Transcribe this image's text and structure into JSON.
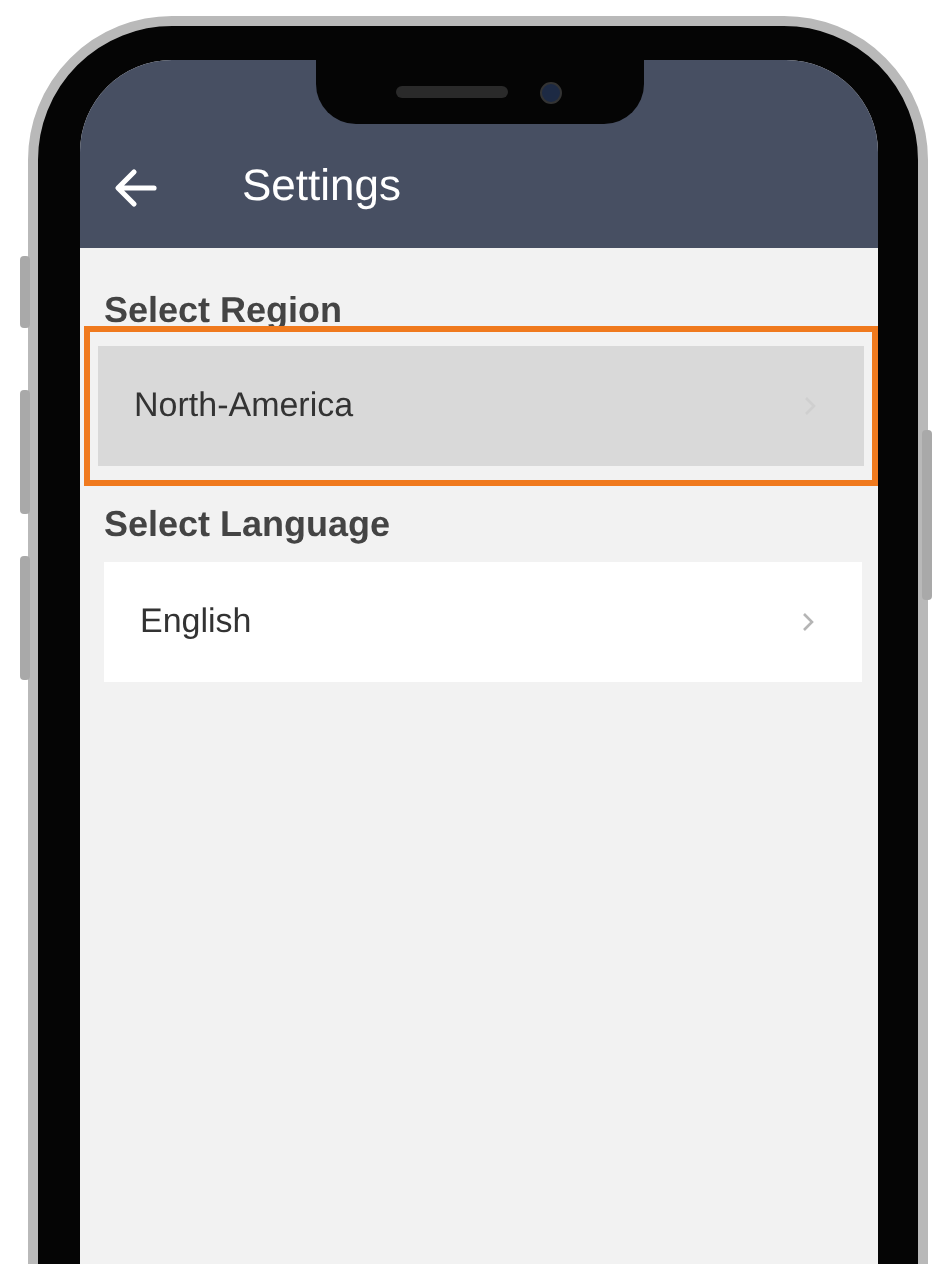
{
  "header": {
    "title": "Settings"
  },
  "sections": [
    {
      "label": "Select Region",
      "item": {
        "value": "North-America",
        "highlighted": true
      }
    },
    {
      "label": "Select Language",
      "item": {
        "value": "English",
        "highlighted": false
      }
    }
  ]
}
